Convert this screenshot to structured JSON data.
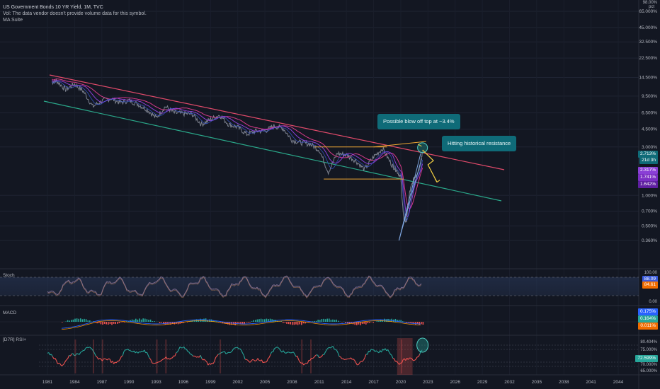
{
  "header": {
    "title": "US Government Bonds 10 YR Yield, 1M, TVC",
    "volume_note": "Vol: The data vendor doesn't provide volume data for this symbol.",
    "indicator": "MA Suite"
  },
  "scale_corner": {
    "top": "98.00%",
    "unit": "pct"
  },
  "annotations": {
    "blowoff": "Possible blow off top at ~3.4%",
    "resistance": "Hitting historical resistance"
  },
  "price_tags": {
    "current": "2.713%",
    "countdown": "21d 3h",
    "ma1": "2.317%",
    "ma2": "1.741%",
    "ma3": "1.642%"
  },
  "panes": {
    "stoch": {
      "label": "Stoch",
      "v1": "88.09",
      "v2": "84.61",
      "upper": "100.00",
      "lower": "0.00"
    },
    "macd": {
      "label": "MACD",
      "v1": "0.175%",
      "v2": "0.164%",
      "v3": "0.011%"
    },
    "rsi": {
      "label": "[D7R] RSI+",
      "v1": "80.404%",
      "v2": "75.000%",
      "v3": "72.599%",
      "v4": "70.000%",
      "v5": "65.000%"
    }
  },
  "colors": {
    "background": "#131722",
    "price": "#7d8290",
    "channel_top": "#e04a6a",
    "channel_bottom": "#2aa88a",
    "box": "#f0a832",
    "ma_purple": "#8a3fd6",
    "ma_blue": "#3b5bdb",
    "ma_pink": "#d63a8a",
    "callout": "#0f6b78",
    "stoch_line": "#7b6a8f",
    "rsi_up": "#26a69a",
    "rsi_down": "#ef5350"
  },
  "chart_data": {
    "type": "line",
    "title": "US Government Bonds 10 YR Yield, 1M, TVC",
    "y_scale": "log",
    "ylim": [
      0.3,
      98
    ],
    "x_ticks": [
      "1981",
      "1984",
      "1987",
      "1990",
      "1993",
      "1996",
      "1999",
      "2002",
      "2005",
      "2008",
      "2011",
      "2014",
      "2017",
      "2020",
      "2023",
      "2026",
      "2029",
      "2032",
      "2035",
      "2038",
      "2041",
      "2044"
    ],
    "y_ticks": [
      "65.000%",
      "45.000%",
      "32.500%",
      "22.500%",
      "14.500%",
      "9.500%",
      "6.500%",
      "4.500%",
      "3.000%",
      "1.000%",
      "0.700%",
      "0.500%",
      "0.360%"
    ],
    "series": [
      {
        "x": [
          1981.5,
          1982,
          1983,
          1984,
          1985,
          1986,
          1987,
          1988,
          1989,
          1990,
          1991,
          1992,
          1993,
          1994,
          1995,
          1996,
          1997,
          1998,
          1999,
          2000,
          2001,
          2002,
          2003,
          2004,
          2005,
          2006,
          2007,
          2008,
          2009,
          2010,
          2011,
          2012,
          2013,
          2014,
          2015,
          2016,
          2017,
          2018,
          2019,
          2019.5,
          2020,
          2020.3,
          2020.6,
          2021,
          2021.5,
          2022,
          2022.4
        ],
        "y": [
          13.0,
          13.5,
          11.0,
          12.5,
          10.5,
          7.5,
          8.5,
          9.0,
          8.2,
          8.6,
          7.9,
          7.0,
          5.8,
          7.5,
          6.5,
          6.4,
          6.3,
          5.0,
          5.6,
          6.2,
          5.0,
          4.7,
          4.0,
          4.3,
          4.3,
          4.8,
          4.6,
          3.5,
          3.3,
          3.2,
          2.8,
          1.7,
          2.6,
          2.5,
          2.2,
          1.8,
          2.4,
          2.9,
          2.0,
          1.8,
          1.5,
          0.6,
          0.55,
          1.1,
          1.5,
          1.8,
          2.7
        ]
      }
    ],
    "levels": {
      "box_top": 3.0,
      "box_bottom": 1.45
    },
    "panes": [
      "Stoch",
      "MACD",
      "[D7R] RSI+"
    ]
  }
}
